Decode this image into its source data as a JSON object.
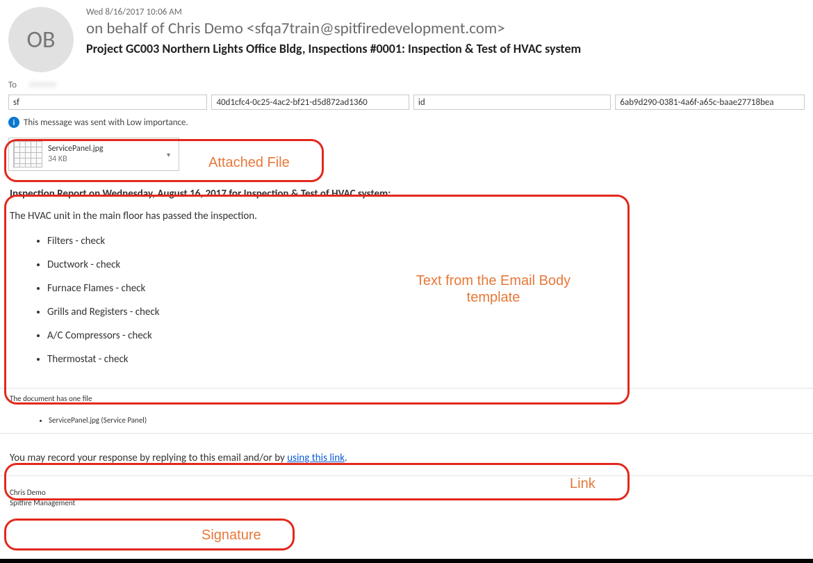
{
  "header": {
    "timestamp": "Wed 8/16/2017 10:06 AM",
    "initials": "OB",
    "from": "on behalf of Chris Demo <sfqa7train@spitfiredevelopment.com>",
    "subject": "Project GC003 Northern Lights Office Bldg, Inspections #0001: Inspection & Test of HVAC system",
    "to_label": "To"
  },
  "fields": {
    "f1": "sf",
    "f2": "40d1cfc4-0c25-4ac2-bf21-d5d872ad1360",
    "f3": "id",
    "f4": "6ab9d290-0381-4a6f-a65c-baae27718bea"
  },
  "importance": {
    "text": "This message was sent with Low importance."
  },
  "attachment": {
    "name": "ServicePanel.jpg",
    "size": "34 KB"
  },
  "body": {
    "report_heading": "Inspection Report on Wednesday, August 16, 2017 for Inspection & Test of HVAC system:",
    "intro": "The HVAC unit in the main floor has passed the inspection.",
    "checks": [
      "Filters - check",
      "Ductwork - check",
      "Furnace Flames - check",
      "Grills and Registers - check",
      "A/C Compressors - check",
      "Thermostat - check"
    ],
    "doc_file_note": "The document has one file",
    "files": [
      "ServicePanel.jpg (Service Panel)"
    ],
    "response_prefix": "You may record your response by replying to this email and/or by ",
    "response_link_text": "using this link",
    "response_suffix": "."
  },
  "signature": {
    "name": "Chris Demo",
    "company": "Spitfire Management"
  },
  "annotations": {
    "attached_file": "Attached File",
    "email_body": "Text from the Email Body template",
    "link": "Link",
    "signature": "Signature"
  }
}
